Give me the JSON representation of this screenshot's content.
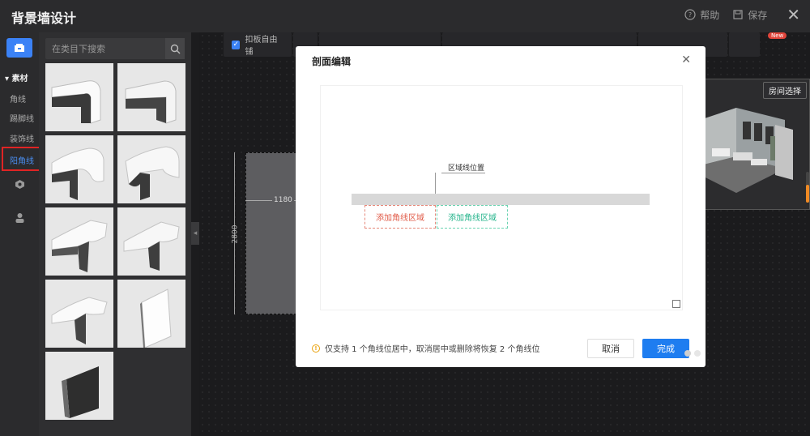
{
  "app": {
    "title": "背景墙设计"
  },
  "topbar": {
    "help_label": "帮助",
    "save_label": "保存"
  },
  "sidebar": {
    "group_label": "素材",
    "items": [
      {
        "label": "角线"
      },
      {
        "label": "踢脚线"
      },
      {
        "label": "装饰线"
      },
      {
        "label": "阳角线"
      }
    ],
    "selected_index": 3
  },
  "search": {
    "placeholder": "在类目下搜索"
  },
  "materials": {
    "icons": [
      "angle-molding-icon",
      "angle-molding-icon",
      "ornate-molding-icon",
      "ornate-molding-icon",
      "ribbed-molding-icon",
      "ribbed-molding-icon",
      "grooved-molding-icon",
      "flat-panel-icon",
      "dark-angle-icon"
    ]
  },
  "toolbar": {
    "free_edit_label": "扣板自由铺",
    "new_badge": "New"
  },
  "canvas": {
    "width_dim": "1180",
    "height_dim": "2800"
  },
  "preview": {
    "room_select_label": "房间选择"
  },
  "dialog": {
    "title": "剖面编辑",
    "position_label": "区域线位置",
    "add_left_label": "添加角线区域",
    "add_right_label": "添加角线区域",
    "notice": "仅支持 1 个角线位居中，取消居中或删除将恢复 2 个角线位",
    "cancel_label": "取消",
    "done_label": "完成"
  },
  "colors": {
    "accent": "#1e7df0",
    "selected_border": "#e02424",
    "add_left": "#e05a47",
    "add_right": "#22b38a"
  }
}
